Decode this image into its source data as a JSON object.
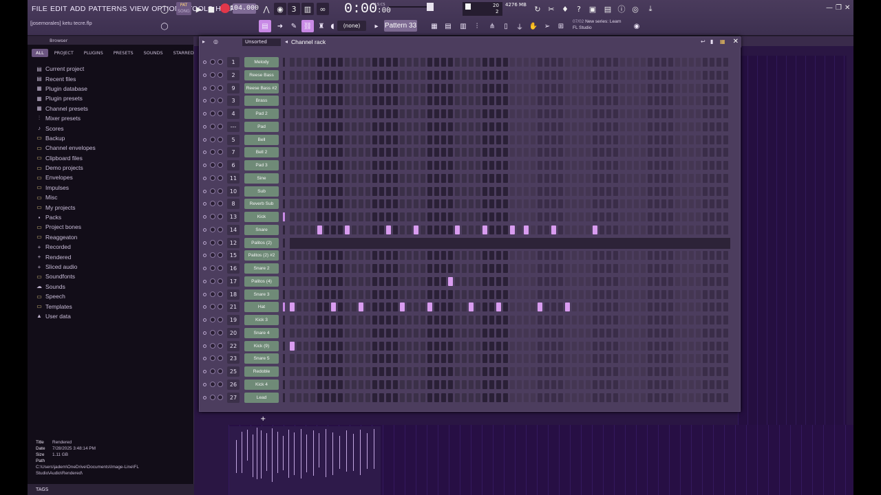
{
  "menu": [
    "FILE",
    "EDIT",
    "ADD",
    "PATTERNS",
    "VIEW",
    "OPTIONS",
    "TOOLS",
    "HELP"
  ],
  "project_name": "[josemorales] ketu tecre.flp",
  "transport": {
    "pat_label": "PAT",
    "song_label": "SONG",
    "tempo": "104.000",
    "time_main": "0:00",
    "time_sub": ":00",
    "time_format": "M:S:CS"
  },
  "cpu": {
    "value_top": "20",
    "value_bottom": "2"
  },
  "memory": "4276 MB",
  "pattern": {
    "none_label": "(none)",
    "current": "Pattern 33"
  },
  "hint": {
    "count": "07/02",
    "line1": "New series: Learn",
    "line2": "FL Studio"
  },
  "browser": {
    "title": "Browser",
    "tabs": [
      "ALL",
      "PROJECT",
      "PLUGINS",
      "PRESETS",
      "SOUNDS",
      "STARRED"
    ],
    "items": [
      {
        "label": "Current project",
        "icon": "▤",
        "type": "special"
      },
      {
        "label": "Recent files",
        "icon": "▤",
        "type": "special"
      },
      {
        "label": "Plugin database",
        "icon": "▦",
        "type": "special"
      },
      {
        "label": "Plugin presets",
        "icon": "▦",
        "type": "special"
      },
      {
        "label": "Channel presets",
        "icon": "▦",
        "type": "special"
      },
      {
        "label": "Mixer presets",
        "icon": "⫶",
        "type": "special"
      },
      {
        "label": "Scores",
        "icon": "♪",
        "type": "special"
      },
      {
        "label": "Backup",
        "icon": "▭",
        "type": "folder"
      },
      {
        "label": "Channel envelopes",
        "icon": "▭",
        "type": "folder"
      },
      {
        "label": "Clipboard files",
        "icon": "▭",
        "type": "folder"
      },
      {
        "label": "Demo projects",
        "icon": "▭",
        "type": "folder"
      },
      {
        "label": "Envelopes",
        "icon": "▭",
        "type": "folder"
      },
      {
        "label": "Impulses",
        "icon": "▭",
        "type": "folder"
      },
      {
        "label": "Misc",
        "icon": "▭",
        "type": "folder"
      },
      {
        "label": "My projects",
        "icon": "▭",
        "type": "folder"
      },
      {
        "label": "Packs",
        "icon": "▪",
        "type": "special"
      },
      {
        "label": "Project bones",
        "icon": "▭",
        "type": "folder"
      },
      {
        "label": "Reaggeaton",
        "icon": "▭",
        "type": "folder"
      },
      {
        "label": "Recorded",
        "icon": "+",
        "type": "special"
      },
      {
        "label": "Rendered",
        "icon": "+",
        "type": "special"
      },
      {
        "label": "Sliced audio",
        "icon": "+",
        "type": "special"
      },
      {
        "label": "Soundfonts",
        "icon": "▭",
        "type": "folder"
      },
      {
        "label": "Sounds",
        "icon": "☁",
        "type": "special"
      },
      {
        "label": "Speech",
        "icon": "▭",
        "type": "folder"
      },
      {
        "label": "Templates",
        "icon": "▭",
        "type": "folder"
      },
      {
        "label": "User data",
        "icon": "▲",
        "type": "special"
      }
    ],
    "info": {
      "title_label": "Title",
      "title": "Rendered",
      "date_label": "Date",
      "date": "7/28/2025 3:48:14 PM",
      "size_label": "Size",
      "size": "1.11 GB",
      "path_label": "Path",
      "path": "C:\\Users\\jadem\\OneDrive\\Documents\\Image-Line\\FL Studio\\Audio\\Rendered\\"
    },
    "tags_label": "TAGS"
  },
  "rack": {
    "sort_label": "Unsorted",
    "title": "Channel rack",
    "channels": [
      {
        "num": "1",
        "name": "Melody"
      },
      {
        "num": "2",
        "name": "Reese Bass"
      },
      {
        "num": "9",
        "name": "Reese Bass #2"
      },
      {
        "num": "3",
        "name": "Brass"
      },
      {
        "num": "4",
        "name": "Pad 2"
      },
      {
        "num": "---",
        "name": "Pad"
      },
      {
        "num": "5",
        "name": "Bell"
      },
      {
        "num": "7",
        "name": "Bell 2"
      },
      {
        "num": "6",
        "name": "Pad 3"
      },
      {
        "num": "11",
        "name": "Sine"
      },
      {
        "num": "10",
        "name": "Sub"
      },
      {
        "num": "8",
        "name": "Reverb Sub"
      },
      {
        "num": "13",
        "name": "Kick",
        "selected": true
      },
      {
        "num": "14",
        "name": "Snare",
        "active": [
          4,
          8,
          14,
          18,
          24,
          28,
          32,
          34,
          38,
          44
        ]
      },
      {
        "num": "12",
        "name": "Palitos (2)",
        "graph": true
      },
      {
        "num": "15",
        "name": "Palitos (2) #2"
      },
      {
        "num": "16",
        "name": "Snare 2"
      },
      {
        "num": "17",
        "name": "Palitos (4)",
        "active": [
          23
        ]
      },
      {
        "num": "18",
        "name": "Snare 3"
      },
      {
        "num": "21",
        "name": "Hat",
        "selected": true,
        "active": [
          0,
          6,
          10,
          16,
          20,
          26,
          30,
          36,
          40
        ]
      },
      {
        "num": "19",
        "name": "Kick 3"
      },
      {
        "num": "20",
        "name": "Snare 4"
      },
      {
        "num": "22",
        "name": "Kick (9)",
        "active": [
          0
        ]
      },
      {
        "num": "23",
        "name": "Snare 5"
      },
      {
        "num": "25",
        "name": "Redoble"
      },
      {
        "num": "26",
        "name": "Kick 4"
      },
      {
        "num": "27",
        "name": "Lead"
      }
    ],
    "add_label": "+"
  },
  "colors": {
    "step_dark": "#2a2036",
    "step_light": "#3b3048",
    "step_active": "#d99cf0",
    "accent": "#c98ae6"
  }
}
